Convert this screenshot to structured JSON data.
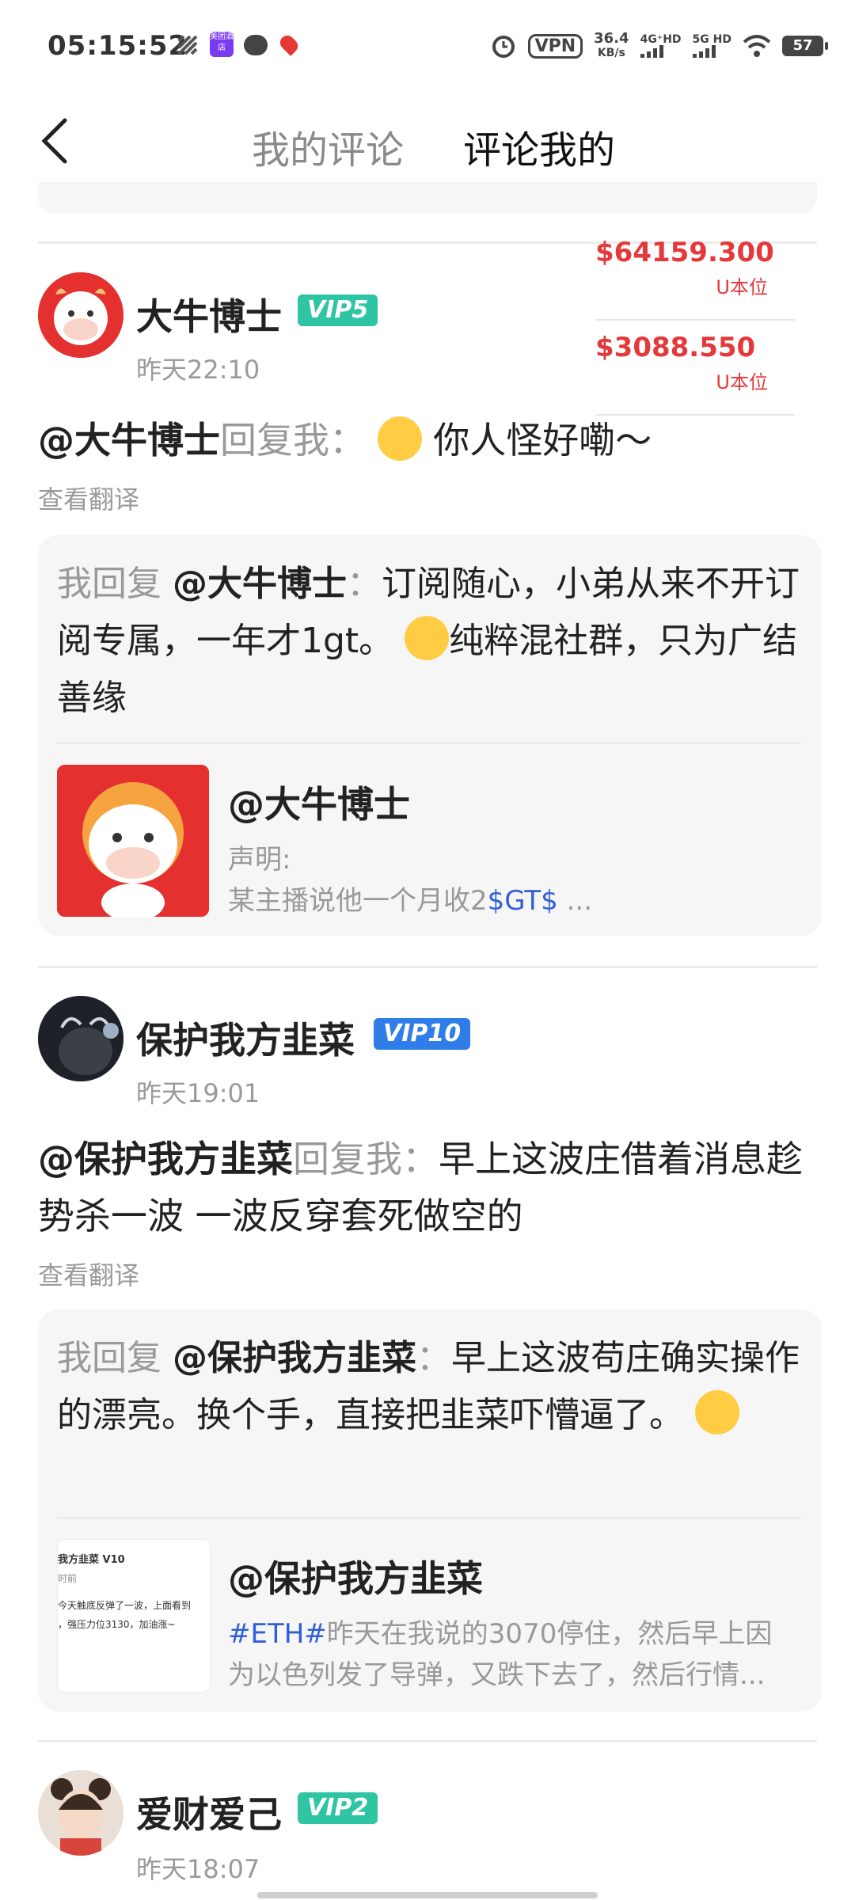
{
  "status_bar": {
    "time": "05:15:52",
    "hotel_badge": "美团酒店",
    "vpn": "VPN",
    "speed_value": "36.4",
    "speed_unit": "KB/s",
    "net1": "4G⁺HD",
    "net2": "5G HD",
    "battery": "57"
  },
  "header": {
    "tab_my_comments": "我的评论",
    "tab_comments_on_me": "评论我的"
  },
  "price_widget": {
    "price1": "$64159.300",
    "unit1": "U本位",
    "price2": "$3088.550",
    "unit2": "U本位"
  },
  "comments": [
    {
      "username": "大牛博士",
      "vip": "VIP5",
      "time": "昨天22:10",
      "reply_name": "@大牛博士",
      "reply_verb": "回复我：",
      "reply_text": "你人怪好嘞～",
      "translate": "查看翻译",
      "my_reply_prefix": "我回复",
      "my_reply_target": "@大牛博士",
      "my_reply_colon": "：",
      "my_reply_text": "订阅随心，小弟从来不开订阅专属，一年才1gt。",
      "my_reply_text2": "纯粹混社群，只为广结善缘",
      "post_author": "@大牛博士",
      "post_line1": "声明:",
      "post_line2": "某主播说他一个月收2",
      "post_tag": "$GT$",
      "post_tail": " ..."
    },
    {
      "username": "保护我方韭菜",
      "vip": "VIP10",
      "time": "昨天19:01",
      "reply_name": "@保护我方韭菜",
      "reply_verb": "回复我：",
      "reply_text": "早上这波庄借着消息趁势杀一波  一波反穿套死做空的",
      "translate": "查看翻译",
      "my_reply_prefix": "我回复",
      "my_reply_target": "@保护我方韭菜",
      "my_reply_colon": "：",
      "my_reply_text": "早上这波苟庄确实操作的漂亮。换个手，直接把韭菜吓懵逼了。",
      "post_author": "@保护我方韭菜",
      "post_tag": "#ETH#",
      "post_line1": "昨天在我说的3070停住，然后早上因",
      "post_line2": "为以色列发了导弹，又跌下去了，然后行情...",
      "thumb_line1": "我方韭菜 V10",
      "thumb_line2": "时前",
      "thumb_line3": "今天触底反弹了一波，上面看到",
      "thumb_line4": "，强压力位3130，加油涨~"
    },
    {
      "username": "爱财爱己",
      "vip": "VIP2",
      "time": "昨天18:07"
    }
  ]
}
